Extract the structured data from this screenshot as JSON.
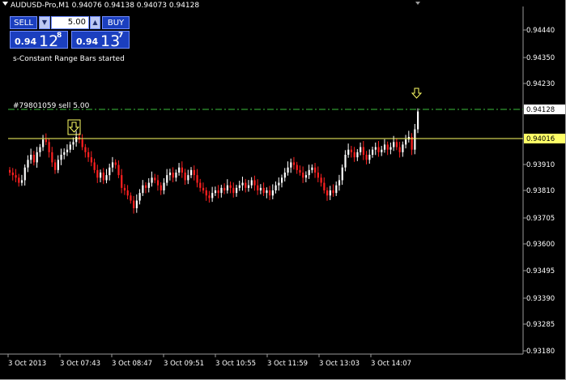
{
  "window": {
    "header_text": "AUDUSD-Pro,M1  0.94076 0.94138 0.94073 0.94128"
  },
  "trade_panel": {
    "sell_label": "SELL",
    "buy_label": "BUY",
    "lot_value": "5.00",
    "bid": {
      "small": "0.94",
      "big": "12",
      "sup": "8"
    },
    "ask": {
      "small": "0.94",
      "big": "13",
      "sup": "7"
    }
  },
  "messages": {
    "indicator_status": "s-Constant Range Bars started",
    "order_label": "#79801059 sell 5.00"
  },
  "colors": {
    "background": "#000000",
    "bull_bar": "#ffffff",
    "bear_bar": "#ff2020",
    "order_line": "#3bbf3b",
    "bid_line": "#ffff66",
    "arrow": "#ffff66",
    "panel_blue": "#1b3fbf"
  },
  "price_axis": {
    "labels": [
      "0.94440",
      "0.94350",
      "0.94128",
      "0.94016",
      "0.94230",
      "0.93910",
      "0.93810",
      "0.93705",
      "0.93600",
      "0.93495",
      "0.93390",
      "0.93285",
      "0.93180"
    ],
    "current_order_price": "0.94128",
    "current_bid_price": "0.94016"
  },
  "time_axis": {
    "labels": [
      "3 Oct 2013",
      "3 Oct 07:43",
      "3 Oct 08:47",
      "3 Oct 09:51",
      "3 Oct 10:55",
      "3 Oct 11:59",
      "3 Oct 13:03",
      "3 Oct 14:07"
    ]
  },
  "chart_data": {
    "type": "candlestick",
    "symbol": "AUDUSD-Pro",
    "timeframe": "M1",
    "ylim": [
      0.9318,
      0.945
    ],
    "y_ticks": [
      0.9318,
      0.93285,
      0.9339,
      0.93495,
      0.936,
      0.93705,
      0.9381,
      0.9391,
      0.94016,
      0.94128,
      0.9423,
      0.9435,
      0.9444
    ],
    "closes": [
      0.9388,
      0.9387,
      0.9386,
      0.9384,
      0.9385,
      0.939,
      0.9393,
      0.9395,
      0.9392,
      0.9396,
      0.9398,
      0.9401,
      0.94,
      0.9396,
      0.9392,
      0.9389,
      0.9393,
      0.9395,
      0.9396,
      0.9397,
      0.9399,
      0.94,
      0.9402,
      0.9401,
      0.9398,
      0.9396,
      0.9394,
      0.9392,
      0.9389,
      0.9386,
      0.9388,
      0.9385,
      0.9387,
      0.939,
      0.9392,
      0.9391,
      0.9387,
      0.9382,
      0.9381,
      0.9379,
      0.9377,
      0.9374,
      0.9377,
      0.938,
      0.9383,
      0.9382,
      0.9384,
      0.9386,
      0.9385,
      0.9383,
      0.9381,
      0.9384,
      0.9387,
      0.9388,
      0.9386,
      0.9388,
      0.939,
      0.9388,
      0.9385,
      0.9387,
      0.9389,
      0.9387,
      0.9384,
      0.9382,
      0.9381,
      0.9379,
      0.9378,
      0.938,
      0.9381,
      0.938,
      0.9382,
      0.9381,
      0.9383,
      0.9382,
      0.938,
      0.9382,
      0.9383,
      0.9384,
      0.9382,
      0.9383,
      0.9385,
      0.9383,
      0.9381,
      0.9382,
      0.938,
      0.9381,
      0.9379,
      0.9381,
      0.9383,
      0.9384,
      0.9386,
      0.9388,
      0.939,
      0.9392,
      0.9391,
      0.9389,
      0.9388,
      0.9386,
      0.9387,
      0.9389,
      0.939,
      0.9388,
      0.9386,
      0.9384,
      0.9381,
      0.9379,
      0.9381,
      0.938,
      0.9383,
      0.9385,
      0.939,
      0.9395,
      0.9397,
      0.9396,
      0.9394,
      0.9396,
      0.9398,
      0.9395,
      0.9393,
      0.9395,
      0.9397,
      0.9398,
      0.9396,
      0.9397,
      0.9399,
      0.9397,
      0.9398,
      0.94,
      0.9398,
      0.9396,
      0.9399,
      0.9401,
      0.9402,
      0.9397,
      0.9405,
      0.9412
    ]
  }
}
